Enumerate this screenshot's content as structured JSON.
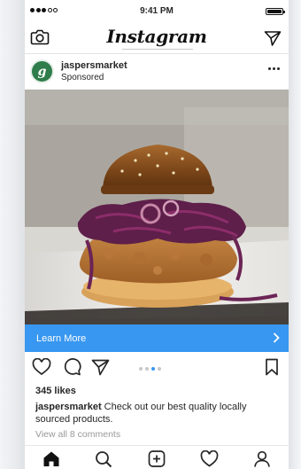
{
  "status_bar": {
    "time": "9:41 PM",
    "signal_dots": 5,
    "signal_filled": 3
  },
  "top_nav": {
    "logo": "Instagram",
    "icons": [
      "camera-icon",
      "send-icon"
    ]
  },
  "post": {
    "username": "jaspersmarket",
    "avatar_letter": "g",
    "subtitle": "Sponsored",
    "image_subject": "fried chicken burger",
    "cta_label": "Learn More",
    "cta_color": "#3897f0",
    "carousel": {
      "count": 4,
      "active_index": 2
    },
    "likes": "345 likes",
    "caption_user": "jaspersmarket",
    "caption_text": "Check out our best quality locally sourced products.",
    "comments_link": "View all 8 comments"
  },
  "tab_bar": {
    "items": [
      "home-icon",
      "search-icon",
      "add-icon",
      "heart-icon",
      "profile-icon"
    ],
    "active": "home-icon"
  }
}
